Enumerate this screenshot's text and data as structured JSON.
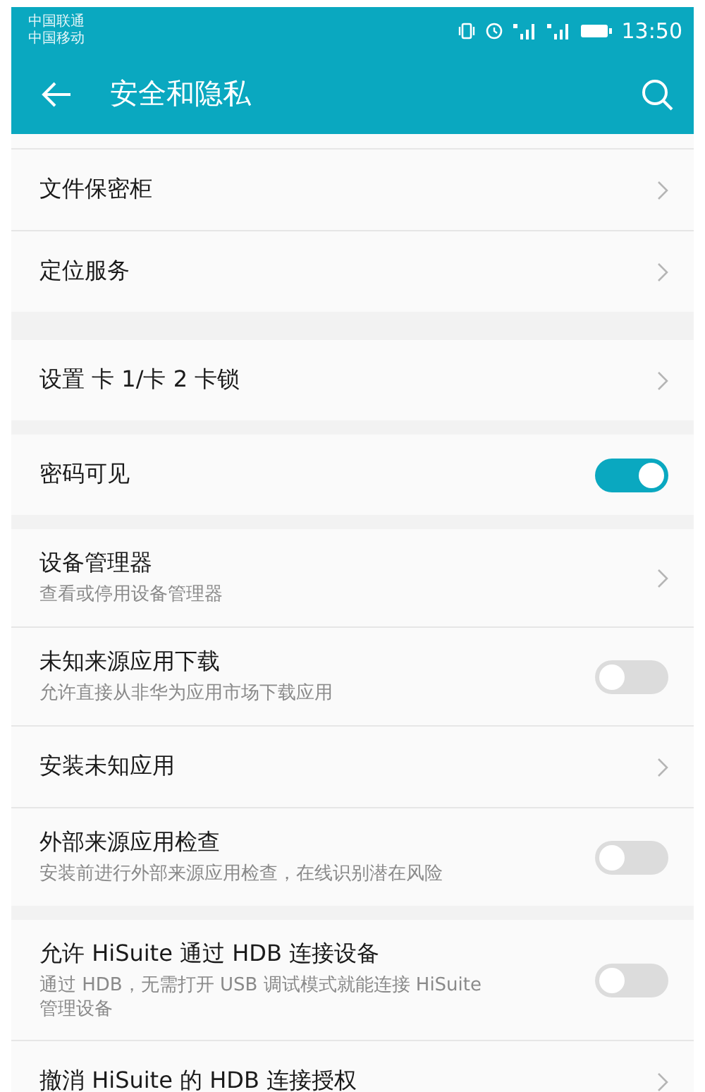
{
  "status_bar": {
    "carriers": [
      "中国联通",
      "中国移动"
    ],
    "time": "13:50"
  },
  "app_bar": {
    "title": "安全和隐私"
  },
  "groups": [
    {
      "rows": [
        {
          "kind": "link",
          "title": "文件保密柜"
        },
        {
          "kind": "link",
          "title": "定位服务"
        }
      ]
    },
    {
      "rows": [
        {
          "kind": "link",
          "title": "设置 卡 1/卡 2 卡锁"
        }
      ]
    },
    {
      "rows": [
        {
          "kind": "switch",
          "title": "密码可见",
          "on": true
        }
      ]
    },
    {
      "rows": [
        {
          "kind": "link",
          "title": "设备管理器",
          "subtitle": "查看或停用设备管理器"
        },
        {
          "kind": "switch",
          "title": "未知来源应用下载",
          "subtitle": "允许直接从非华为应用市场下载应用",
          "on": false
        },
        {
          "kind": "link",
          "title": "安装未知应用"
        },
        {
          "kind": "switch",
          "title": "外部来源应用检查",
          "subtitle": "安装前进行外部来源应用检查，在线识别潜在风险",
          "on": false
        }
      ]
    },
    {
      "rows": [
        {
          "kind": "switch",
          "title": "允许 HiSuite 通过 HDB 连接设备",
          "subtitle": "通过 HDB，无需打开 USB 调试模式就能连接 HiSuite 管理设备",
          "on": false
        },
        {
          "kind": "link",
          "title": "撤消 HiSuite 的 HDB 连接授权"
        }
      ]
    }
  ]
}
